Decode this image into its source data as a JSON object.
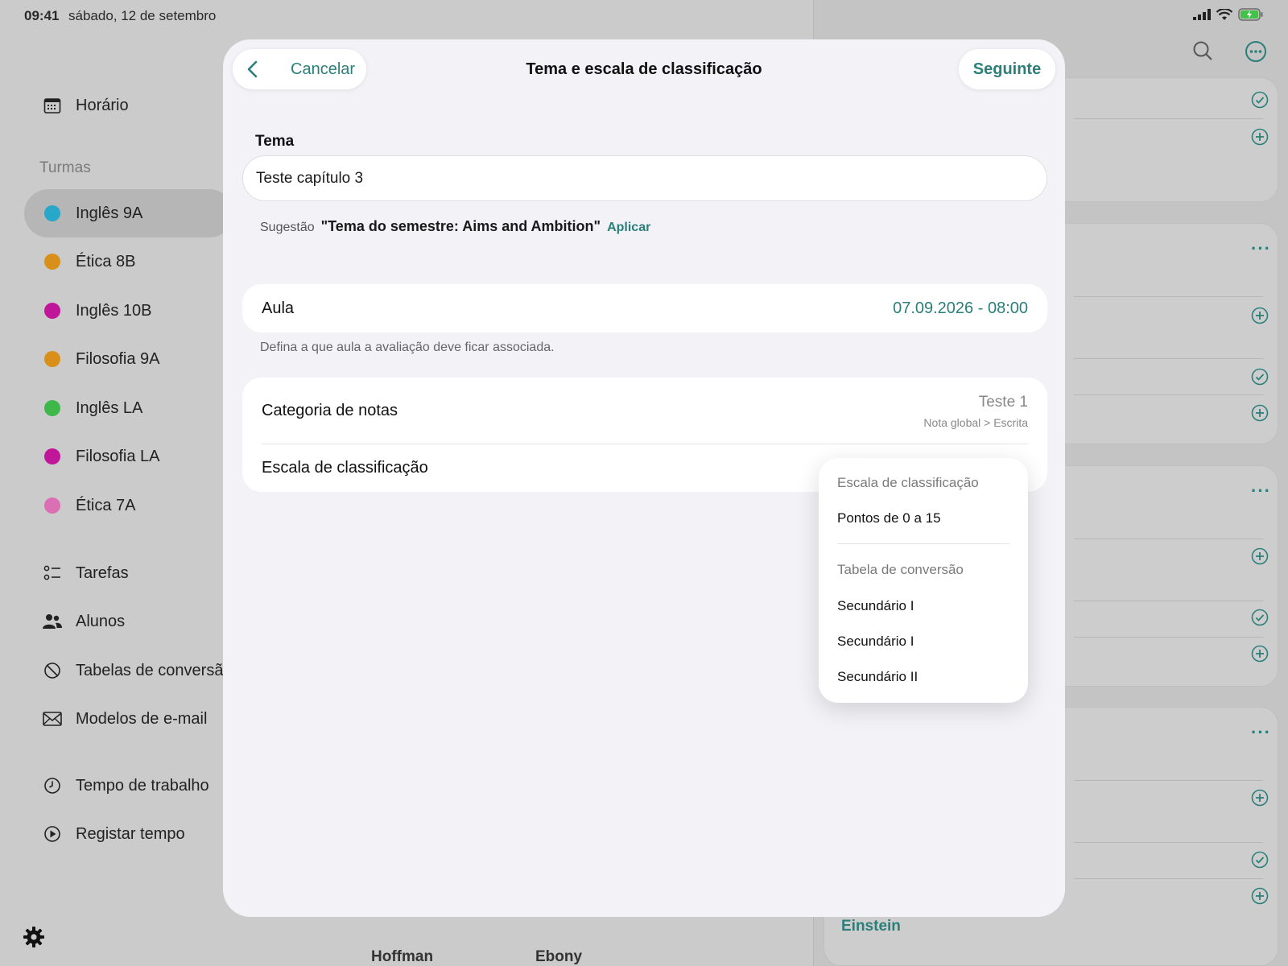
{
  "status": {
    "time": "09:41",
    "date": "sábado, 12 de setembro"
  },
  "sidebar": {
    "schedule_label": "Horário",
    "classes_heading": "Turmas",
    "classes": [
      {
        "label": "Inglês 9A",
        "color": "#27a7c9"
      },
      {
        "label": "Ética 8B",
        "color": "#d9901a"
      },
      {
        "label": "Inglês 10B",
        "color": "#c0169a"
      },
      {
        "label": "Filosofia 9A",
        "color": "#d9901a"
      },
      {
        "label": "Inglês LA",
        "color": "#3fb84a"
      },
      {
        "label": "Filosofia LA",
        "color": "#c0169a"
      },
      {
        "label": "Ética 7A",
        "color": "#db6fb4"
      }
    ],
    "tools": [
      {
        "label": "Tarefas"
      },
      {
        "label": "Alunos"
      },
      {
        "label": "Tabelas de conversão"
      },
      {
        "label": "Modelos de e-mail"
      }
    ],
    "time_items": [
      {
        "label": "Tempo de trabalho"
      },
      {
        "label": "Registar tempo"
      }
    ]
  },
  "background": {
    "einstein": "Einstein",
    "name_1": "Hoffman",
    "name_2": "Ebony"
  },
  "modal": {
    "cancel_label": "Cancelar",
    "title": "Tema e escala de classificação",
    "next_label": "Seguinte",
    "topic_label": "Tema",
    "topic_value": "Teste capítulo 3",
    "suggestion_label": "Sugestão",
    "suggestion_text": "\"Tema do semestre: Aims and Ambition\"",
    "suggestion_apply": "Aplicar",
    "lesson_label": "Aula",
    "lesson_value": "07.09.2026 - 08:00",
    "lesson_hint": "Defina a que aula a avaliação deve ficar associada.",
    "grade_category_label": "Categoria de notas",
    "grade_category_value": "Teste 1",
    "grade_category_path": "Nota global > Escrita",
    "grading_scale_label": "Escala de classificação"
  },
  "dropdown": {
    "scale_heading": "Escala de classificação",
    "scale_option": "Pontos de 0 a 15",
    "conversion_heading": "Tabela de conversão",
    "conversion_options": [
      "Secundário I",
      "Secundário I",
      "Secundário II"
    ]
  },
  "colors": {
    "accent": "#2a7f7a"
  }
}
